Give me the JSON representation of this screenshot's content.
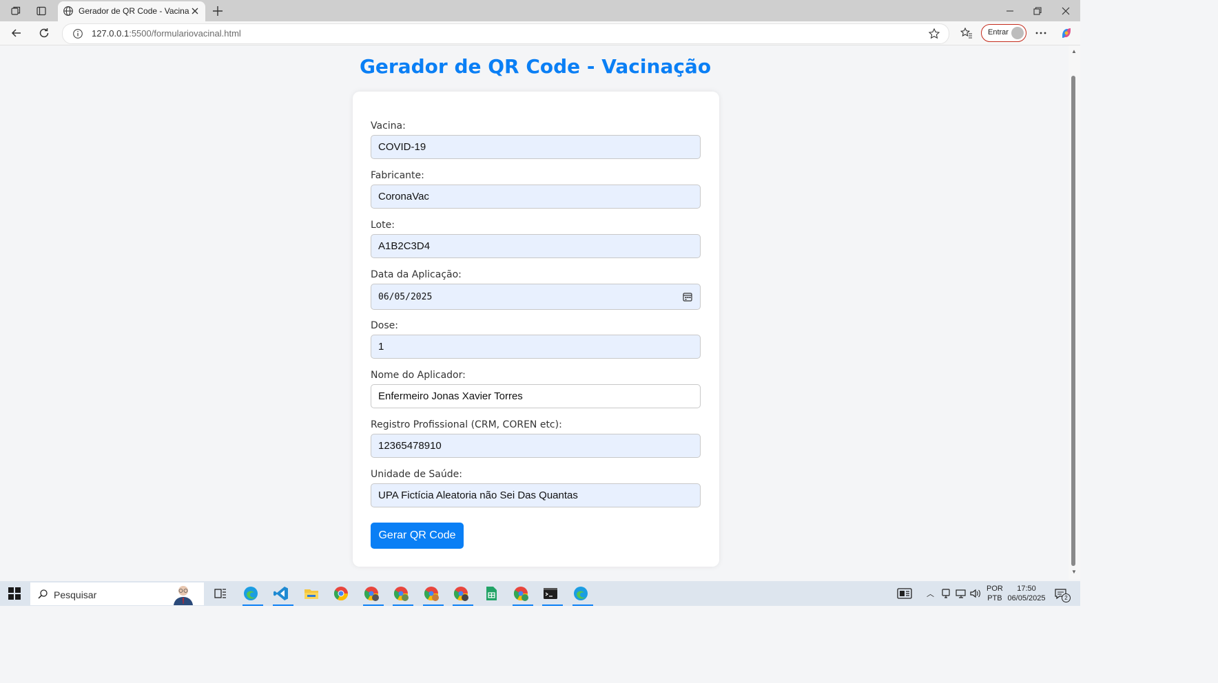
{
  "browser": {
    "tab_title": "Gerador de QR Code - Vacina",
    "url_host": "127.0.0.1",
    "url_path": ":5500/formulariovacinal.html",
    "signin_label": "Entrar"
  },
  "page": {
    "title": "Gerador de QR Code - Vacinação"
  },
  "form": {
    "vacina": {
      "label": "Vacina:",
      "value": "COVID-19"
    },
    "fabricante": {
      "label": "Fabricante:",
      "value": "CoronaVac"
    },
    "lote": {
      "label": "Lote:",
      "value": "A1B2C3D4"
    },
    "data": {
      "label": "Data da Aplicação:",
      "value": "06/05/2025"
    },
    "dose": {
      "label": "Dose:",
      "value": "1"
    },
    "aplicador": {
      "label": "Nome do Aplicador:",
      "value": "Enfermeiro Jonas Xavier Torres"
    },
    "registro": {
      "label": "Registro Profissional (CRM, COREN etc):",
      "value": "12365478910"
    },
    "unidade": {
      "label": "Unidade de Saúde:",
      "value": "UPA Fictícia Aleatoria não Sei Das Quantas"
    },
    "submit_label": "Gerar QR Code"
  },
  "taskbar": {
    "search_placeholder": "Pesquisar",
    "lang_1": "POR",
    "lang_2": "PTB",
    "time": "17:50",
    "date": "06/05/2025",
    "notification_count": "2"
  },
  "colors": {
    "accent": "#0a7ff5",
    "autofill_bg": "#e8f0fe"
  }
}
